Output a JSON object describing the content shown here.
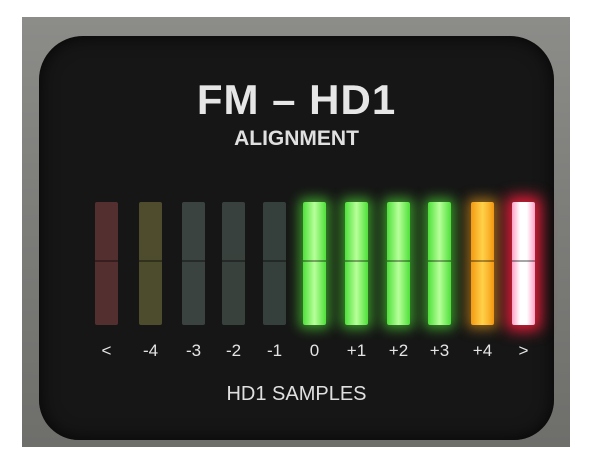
{
  "display": {
    "title": "FM – HD1",
    "subtitle": "ALIGNMENT",
    "footer_label": "HD1 SAMPLES"
  },
  "segments": [
    {
      "label": "<",
      "state": "off",
      "color": "#5b3232"
    },
    {
      "label": "-4",
      "state": "off",
      "color": "#545230"
    },
    {
      "label": "-3",
      "state": "off",
      "color": "#3e4844"
    },
    {
      "label": "-2",
      "state": "off",
      "color": "#3c4641"
    },
    {
      "label": "-1",
      "state": "off",
      "color": "#394440"
    },
    {
      "label": "0",
      "state": "lit",
      "color": "#7cf05a"
    },
    {
      "label": "+1",
      "state": "lit",
      "color": "#7cf05a"
    },
    {
      "label": "+2",
      "state": "lit",
      "color": "#7cf05a"
    },
    {
      "label": "+3",
      "state": "lit",
      "color": "#7cf05a"
    },
    {
      "label": "+4",
      "state": "lit",
      "color": "#ffb52a"
    },
    {
      "label": ">",
      "state": "lit",
      "color": "#ff2a4a"
    }
  ]
}
